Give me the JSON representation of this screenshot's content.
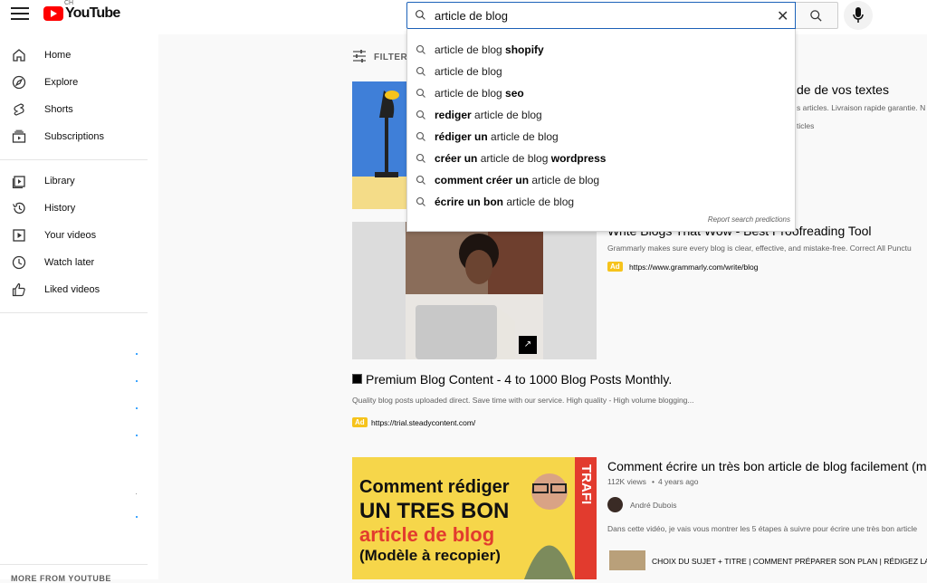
{
  "header": {
    "logo_text": "YouTube",
    "country_code": "CH",
    "search_value": "article de blog"
  },
  "sidebar": {
    "main_items": [
      {
        "label": "Home",
        "icon": "home-icon"
      },
      {
        "label": "Explore",
        "icon": "compass-icon"
      },
      {
        "label": "Shorts",
        "icon": "shorts-icon"
      },
      {
        "label": "Subscriptions",
        "icon": "subscriptions-icon"
      }
    ],
    "library_items": [
      {
        "label": "Library",
        "icon": "library-icon"
      },
      {
        "label": "History",
        "icon": "history-icon"
      },
      {
        "label": "Your videos",
        "icon": "your-videos-icon"
      },
      {
        "label": "Watch later",
        "icon": "clock-icon"
      },
      {
        "label": "Liked videos",
        "icon": "thumbs-up-icon"
      }
    ],
    "more_heading": "MORE FROM YOUTUBE"
  },
  "filters_label": "FILTERS",
  "suggestions": [
    {
      "pre": "article de blog ",
      "bold": "shopify",
      "post": ""
    },
    {
      "pre": "article de blog",
      "bold": "",
      "post": ""
    },
    {
      "pre": "article de blog ",
      "bold": "seo",
      "post": ""
    },
    {
      "pre": "",
      "bold": "rediger",
      "post": " article de blog"
    },
    {
      "pre": "",
      "bold": "rédiger un",
      "post": " article de blog"
    },
    {
      "pre": "",
      "bold": "créer un",
      "post": " article de blog wordpress",
      "bold_tail": "wordpress"
    },
    {
      "pre": "",
      "bold": "comment créer un",
      "post": " article de blog"
    },
    {
      "pre": "",
      "bold": "écrire un bon",
      "post": " article de blog"
    }
  ],
  "report_predictions": "Report search predictions",
  "results": {
    "ad1": {
      "title_partial": "de de vos textes",
      "desc_partial": "s articles. Livraison rapide garantie. N",
      "desc2_partial": "ticles"
    },
    "ad2": {
      "title": "Write Blogs That Wow - Best Proofreading Tool",
      "desc": "Grammarly makes sure every blog is clear, effective, and mistake-free. Correct All Punctu",
      "badge": "Ad",
      "url": "https://www.grammarly.com/write/blog"
    },
    "ad3": {
      "title": "Premium Blog Content - 4 to 1000 Blog Posts Monthly.",
      "desc": "Quality blog posts uploaded direct. Save time with our service. High quality - High volume blogging...",
      "badge": "Ad",
      "url": "https://trial.steadycontent.com/"
    },
    "video1": {
      "title": "Comment écrire un très bon article de blog facilement (mo",
      "views": "112K views",
      "age": "4 years ago",
      "channel": "André Dubois",
      "desc": "Dans cette vidéo, je vais vous montrer les 5 étapes à suivre pour écrire une très bon article",
      "chapters": "CHOIX DU SUJET + TITRE | COMMENT PRÉPARER SON PLAN | RÉDIGEZ LA I",
      "thumb_lines": [
        "Comment rédiger",
        "UN TRES BON",
        "article de blog",
        "(Modèle à recopier)"
      ],
      "thumb_side": "TRAFI"
    }
  },
  "colors": {
    "accent": "#1c62b9",
    "yt_red": "#ff0000",
    "ad_yellow": "#f6c31c",
    "link_blue": "#3ea6ff"
  }
}
